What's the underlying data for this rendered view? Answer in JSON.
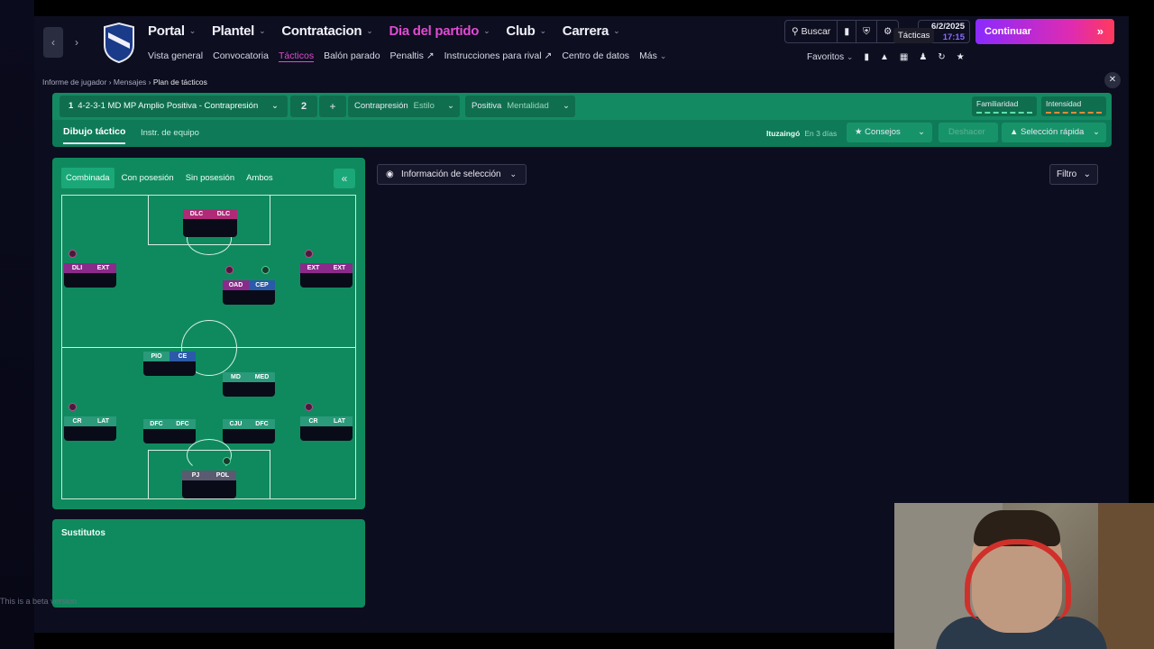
{
  "header": {
    "menu": [
      {
        "label": "Portal",
        "active": false
      },
      {
        "label": "Plantel",
        "active": false
      },
      {
        "label": "Contratacion",
        "active": false
      },
      {
        "label": "Dia del partido",
        "active": true
      },
      {
        "label": "Club",
        "active": false
      },
      {
        "label": "Carrera",
        "active": false
      }
    ],
    "submenu": [
      "Vista general",
      "Convocatoria",
      "Tácticos",
      "Balón parado",
      "Penaltis",
      "Instrucciones para rival",
      "Centro de datos",
      "Más"
    ],
    "search_label": "Buscar",
    "date": "6/2/2025",
    "time": "17:15",
    "tooltip": "Tácticas",
    "continue_label": "Continuar",
    "favorites_label": "Favoritos"
  },
  "breadcrumb": [
    "Informe de jugador",
    "Mensajes",
    "Plan de tácticos"
  ],
  "tactic": {
    "number": "1",
    "name": "4-2-3-1 MD MP Amplio Positiva - Contrapresión",
    "slot": "2",
    "style_value": "Contrapresión",
    "style_label": "Estilo",
    "mentality_value": "Positiva",
    "mentality_label": "Mentalidad",
    "familiarity_label": "Familiaridad",
    "intensity_label": "Intensidad",
    "tab_drawing": "Dibujo táctico",
    "tab_instructions": "Instr. de equipo",
    "next_opponent": "Ituzaingó",
    "next_in": "En 3 días",
    "advice_label": "Consejos",
    "undo_label": "Deshacer",
    "quick_select_label": "Selección rápida"
  },
  "pitch_tabs": [
    "Combinada",
    "Con posesión",
    "Sin posesión",
    "Ambos"
  ],
  "players": [
    {
      "roles": [
        "DLC",
        "DLC"
      ]
    },
    {
      "roles": [
        "DLI",
        "EXT"
      ]
    },
    {
      "roles": [
        "OAD",
        "CEP"
      ]
    },
    {
      "roles": [
        "EXT",
        "EXT"
      ]
    },
    {
      "roles": [
        "PIO",
        "CE"
      ]
    },
    {
      "roles": [
        "MD",
        "MED"
      ]
    },
    {
      "roles": [
        "CR",
        "LAT"
      ]
    },
    {
      "roles": [
        "DFC",
        "DFC"
      ]
    },
    {
      "roles": [
        "CJU",
        "DFC"
      ]
    },
    {
      "roles": [
        "CR",
        "LAT"
      ]
    },
    {
      "roles": [
        "PJ",
        "POL"
      ]
    }
  ],
  "subs_title": "Sustitutos",
  "info_label": "Información de selección",
  "filter_label": "Filtro",
  "beta_text": "This is a beta version"
}
